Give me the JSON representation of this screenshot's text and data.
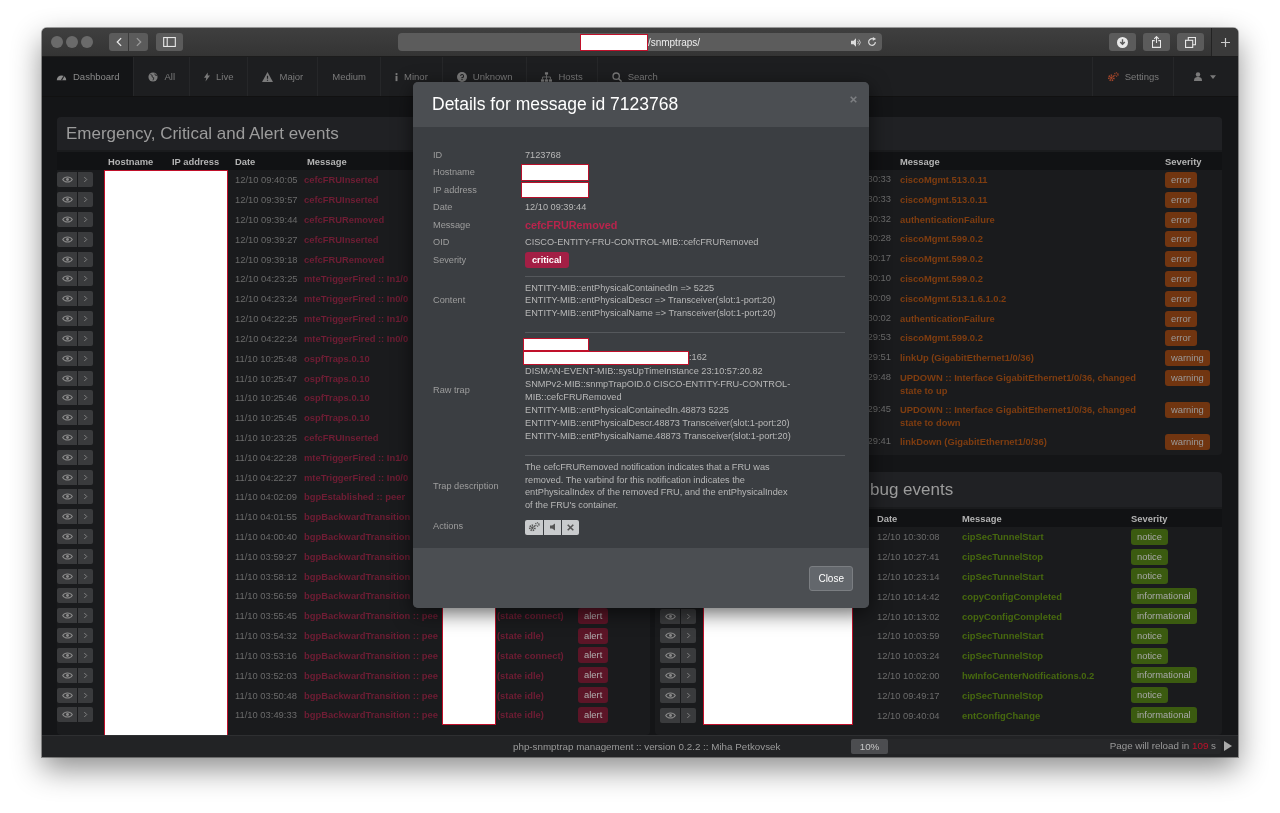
{
  "browser": {
    "url_path": "/snmptraps/"
  },
  "nav": {
    "items": [
      {
        "label": "Dashboard",
        "selected": true
      },
      {
        "label": "All",
        "selected": false
      },
      {
        "label": "Live",
        "selected": false
      },
      {
        "label": "Major",
        "selected": false
      },
      {
        "label": "Medium",
        "selected": false
      },
      {
        "label": "Minor",
        "selected": false
      },
      {
        "label": "Unknown",
        "selected": false
      },
      {
        "label": "Hosts",
        "selected": false
      },
      {
        "label": "Search",
        "selected": false
      }
    ],
    "settings": {
      "label": "Settings"
    }
  },
  "panels": [
    {
      "kind": "critical",
      "title": "Emergency, Critical and Alert events",
      "columns": [
        "Hostname",
        "IP address",
        "Date",
        "Message"
      ],
      "rows": [
        {
          "date": "12/10 09:40:05",
          "message": "cefcFRUInserted"
        },
        {
          "date": "12/10 09:39:57",
          "message": "cefcFRUInserted"
        },
        {
          "date": "12/10 09:39:44",
          "message": "cefcFRURemoved"
        },
        {
          "date": "12/10 09:39:27",
          "message": "cefcFRUInserted"
        },
        {
          "date": "12/10 09:39:18",
          "message": "cefcFRURemoved"
        },
        {
          "date": "12/10 04:23:25",
          "message": "mteTriggerFired :: In1/0"
        },
        {
          "date": "12/10 04:23:24",
          "message": "mteTriggerFired :: In0/0"
        },
        {
          "date": "12/10 04:22:25",
          "message": "mteTriggerFired :: In1/0"
        },
        {
          "date": "12/10 04:22:24",
          "message": "mteTriggerFired :: In0/0"
        },
        {
          "date": "11/10 10:25:48",
          "message": "ospfTraps.0.10"
        },
        {
          "date": "11/10 10:25:47",
          "message": "ospfTraps.0.10"
        },
        {
          "date": "11/10 10:25:46",
          "message": "ospfTraps.0.10"
        },
        {
          "date": "11/10 10:25:45",
          "message": "ospfTraps.0.10"
        },
        {
          "date": "11/10 10:23:25",
          "message": "cefcFRUInserted"
        },
        {
          "date": "11/10 04:22:28",
          "message": "mteTriggerFired :: In1/0"
        },
        {
          "date": "11/10 04:22:27",
          "message": "mteTriggerFired :: In0/0"
        },
        {
          "date": "11/10 04:02:09",
          "message": "bgpEstablished :: peer"
        },
        {
          "date": "11/10 04:01:55",
          "message": "bgpBackwardTransition"
        },
        {
          "date": "11/10 04:00:40",
          "message": "bgpBackwardTransition"
        },
        {
          "date": "11/10 03:59:27",
          "message": "bgpBackwardTransition"
        },
        {
          "date": "11/10 03:58:12",
          "message": "bgpBackwardTransition"
        },
        {
          "date": "11/10 03:56:59",
          "message": "bgpBackwardTransition"
        },
        {
          "date": "11/10 03:55:45",
          "message": "bgpBackwardTransition :: pee",
          "message_end": "(state connect)",
          "severity": "alert"
        },
        {
          "date": "11/10 03:54:32",
          "message": "bgpBackwardTransition :: pee",
          "message_end": "(state idle)",
          "severity": "alert"
        },
        {
          "date": "11/10 03:53:16",
          "message": "bgpBackwardTransition :: pee",
          "message_end": "(state connect)",
          "severity": "alert"
        },
        {
          "date": "11/10 03:52:03",
          "message": "bgpBackwardTransition :: pee",
          "message_end": "(state idle)",
          "severity": "alert"
        },
        {
          "date": "11/10 03:50:48",
          "message": "bgpBackwardTransition :: pee",
          "message_end": "(state idle)",
          "severity": "alert"
        },
        {
          "date": "11/10 03:49:33",
          "message": "bgpBackwardTransition :: pee",
          "message_end": "(state idle)",
          "severity": "alert"
        }
      ]
    },
    {
      "kind": "error",
      "columns": [
        "Message",
        "Severity"
      ],
      "rows": [
        {
          "date": "30:33",
          "message": "ciscoMgmt.513.0.11",
          "severity": "error"
        },
        {
          "date": "30:33",
          "message": "ciscoMgmt.513.0.11",
          "severity": "error"
        },
        {
          "date": "30:32",
          "message": "authenticationFailure",
          "severity": "error"
        },
        {
          "date": "30:28",
          "message": "ciscoMgmt.599.0.2",
          "severity": "error"
        },
        {
          "date": "30:17",
          "message": "ciscoMgmt.599.0.2",
          "severity": "error"
        },
        {
          "date": "30:10",
          "message": "ciscoMgmt.599.0.2",
          "severity": "error"
        },
        {
          "date": "30:09",
          "message": "ciscoMgmt.513.1.6.1.0.2",
          "severity": "error"
        },
        {
          "date": "30:02",
          "message": "authenticationFailure",
          "severity": "error"
        },
        {
          "date": "29:53",
          "message": "ciscoMgmt.599.0.2",
          "severity": "error"
        },
        {
          "date": "29:51",
          "message": "linkUp (GigabitEthernet1/0/36)",
          "severity": "warning"
        },
        {
          "date": "29:48",
          "message": "UPDOWN :: Interface GigabitEthernet1/0/36, changed state to up",
          "severity": "warning"
        },
        {
          "date": "29:45",
          "message": "UPDOWN :: Interface GigabitEthernet1/0/36, changed state to down",
          "severity": "warning"
        },
        {
          "date": "29:41",
          "message": "linkDown (GigabitEthernet1/0/36)",
          "severity": "warning"
        }
      ]
    },
    {
      "kind": "notice",
      "title": "bug events",
      "columns": [
        "Date",
        "Message",
        "Severity"
      ],
      "rows": [
        {
          "date": "12/10 10:30:08",
          "message": "cipSecTunnelStart",
          "severity": "notice",
          "actions": false
        },
        {
          "date": "12/10 10:27:41",
          "message": "cipSecTunnelStop",
          "severity": "notice",
          "actions": false
        },
        {
          "date": "12/10 10:23:14",
          "message": "cipSecTunnelStart",
          "severity": "notice",
          "actions": false
        },
        {
          "date": "12/10 10:14:42",
          "message": "copyConfigCompleted",
          "severity": "informational",
          "actions": false
        },
        {
          "date": "12/10 10:13:02",
          "message": "copyConfigCompleted",
          "severity": "informational",
          "actions": true
        },
        {
          "date": "12/10 10:03:59",
          "message": "cipSecTunnelStart",
          "severity": "notice",
          "actions": true
        },
        {
          "date": "12/10 10:03:24",
          "message": "cipSecTunnelStop",
          "severity": "notice",
          "actions": true
        },
        {
          "date": "12/10 10:02:00",
          "message": "hwInfoCenterNotifications.0.2",
          "severity": "informational",
          "actions": true
        },
        {
          "date": "12/10 09:49:17",
          "message": "cipSecTunnelStop",
          "severity": "notice",
          "actions": true
        },
        {
          "date": "12/10 09:40:04",
          "message": "entConfigChange",
          "severity": "informational",
          "actions": true
        }
      ]
    }
  ],
  "dialog": {
    "title": "Details for message id 7123768",
    "fields": [
      {
        "label": "ID",
        "kind": "text",
        "value": "7123768"
      },
      {
        "label": "Hostname",
        "kind": "redacted"
      },
      {
        "label": "IP address",
        "kind": "redacted"
      },
      {
        "label": "Date",
        "kind": "text",
        "value": "12/10 09:39:44"
      },
      {
        "label": "Message",
        "kind": "message",
        "value": "cefcFRURemoved"
      },
      {
        "label": "OID",
        "kind": "text",
        "value": "CISCO-ENTITY-FRU-CONTROL-MIB::cefcFRURemoved"
      },
      {
        "label": "Severity",
        "kind": "badge",
        "value": "critical"
      },
      {
        "label": "Content",
        "kind": "lines",
        "lines": [
          {
            "text": "ENTITY-MIB::entPhysicalContainedIn => 5225",
            "redacted": false
          },
          {
            "text": "ENTITY-MIB::entPhysicalDescr => Transceiver(slot:1-port:20)",
            "redacted": false
          },
          {
            "text": "ENTITY-MIB::entPhysicalName => Transceiver(slot:1-port:20)",
            "redacted": false
          }
        ]
      },
      {
        "label": "Raw trap",
        "kind": "lines",
        "lines": [
          {
            "redacted": true
          },
          {
            "text": ":162",
            "redacted": true
          },
          {
            "text": "DISMAN-EVENT-MIB::sysUpTimeInstance 23:10:57:20.82",
            "redacted": false
          },
          {
            "text": "SNMPv2-MIB::snmpTrapOID.0 CISCO-ENTITY-FRU-CONTROL-MIB::cefcFRURemoved",
            "redacted": false
          },
          {
            "text": "ENTITY-MIB::entPhysicalContainedIn.48873 5225",
            "redacted": false
          },
          {
            "text": "ENTITY-MIB::entPhysicalDescr.48873 Transceiver(slot:1-port:20)",
            "redacted": false
          },
          {
            "text": "ENTITY-MIB::entPhysicalName.48873 Transceiver(slot:1-port:20)",
            "redacted": false
          }
        ]
      },
      {
        "label": "Trap description",
        "kind": "paragraph",
        "value": "The cefcFRURemoved notification indicates that a FRU was removed. The varbind for this notification indicates the entPhysicalIndex of the removed FRU, and the entPhysicalIndex of the FRU's container."
      },
      {
        "label": "Actions",
        "kind": "actions"
      }
    ],
    "close_label": "Close"
  },
  "status_bar": {
    "credits": "php-snmptrap management :: version 0.2.2 :: Miha Petkovsek",
    "progress": {
      "label": "10%",
      "level": 0.1
    },
    "reload_label": "Page will reload in",
    "countdown": "109",
    "unit": "s"
  }
}
